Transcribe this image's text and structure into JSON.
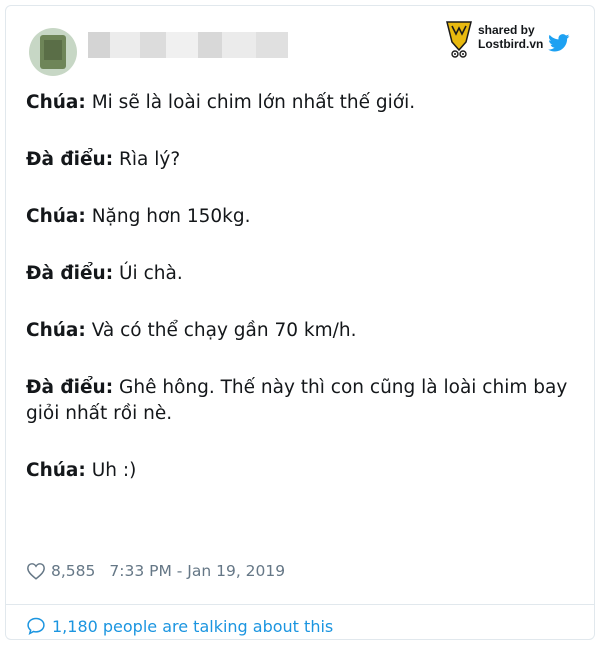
{
  "header": {
    "badge": {
      "line1": "shared by",
      "line2": "Lostbird.vn"
    }
  },
  "tweet": {
    "lines": [
      {
        "speaker": "Chúa:",
        "text": " Mi sẽ là loài chim lớn nhất thế giới."
      },
      {
        "speaker": "Đà điểu:",
        "text": " Rìa lý?"
      },
      {
        "speaker": "Chúa:",
        "text": " Nặng hơn 150kg."
      },
      {
        "speaker": "Đà điểu:",
        "text": " Úi chà."
      },
      {
        "speaker": "Chúa:",
        "text": " Và có thể chạy gần 70 km/h."
      },
      {
        "speaker": "Đà điểu:",
        "text": " Ghê hông. Thế này thì con cũng là loài chim bay"
      },
      {
        "speaker": "",
        "text": "giỏi nhất rồi nè."
      },
      {
        "speaker": "Chúa:",
        "text": " Uh :)"
      }
    ]
  },
  "footer": {
    "likes": "8,585",
    "timestamp": "7:33 PM - Jan 19, 2019",
    "talking": "1,180 people are talking about this"
  },
  "colors": {
    "link": "#1b95e0",
    "meta": "#657786",
    "twitter_blue": "#1da1f2",
    "badge_yellow": "#e8b90f"
  },
  "icons": {
    "heart": "heart-icon",
    "bubble": "speech-bubble-icon",
    "twitter": "twitter-bird-icon",
    "lostbird": "lostbird-logo-icon"
  }
}
